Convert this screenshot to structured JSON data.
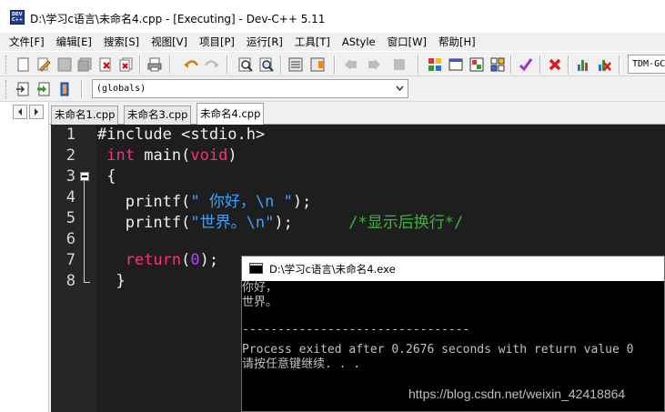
{
  "window": {
    "title": "D:\\学习c语言\\未命名4.cpp - [Executing] - Dev-C++ 5.11",
    "icon": "devcpp-app-icon",
    "icon_text": "DEV C++"
  },
  "menubar": {
    "items": [
      "文件[F]",
      "编辑[E]",
      "搜索[S]",
      "视图[V]",
      "项目[P]",
      "运行[R]",
      "工具[T]",
      "AStyle",
      "窗口[W]",
      "帮助[H]"
    ]
  },
  "toolbar": {
    "compiler_select": "TDM-GCC",
    "scope_select": "(globals)"
  },
  "tabs": {
    "items": [
      "未命名1.cpp",
      "未命名3.cpp",
      "未命名4.cpp"
    ],
    "active_index": 2
  },
  "editor": {
    "line_numbers": [
      "1",
      "2",
      "3",
      "4",
      "5",
      "6",
      "7",
      "8"
    ],
    "lines": [
      [
        {
          "t": "#include <stdio.h>",
          "c": "pp"
        }
      ],
      [
        {
          "t": " ",
          "c": ""
        },
        {
          "t": "int",
          "c": "kw"
        },
        {
          "t": " main(",
          "c": ""
        },
        {
          "t": "void",
          "c": "kw"
        },
        {
          "t": ")",
          "c": ""
        }
      ],
      [
        {
          "t": " {",
          "c": ""
        }
      ],
      [
        {
          "t": "   printf(",
          "c": ""
        },
        {
          "t": "\" 你好，",
          "c": "str"
        },
        {
          "t": "\\n",
          "c": "esc"
        },
        {
          "t": " \"",
          "c": "str"
        },
        {
          "t": ");",
          "c": ""
        }
      ],
      [
        {
          "t": "   printf(",
          "c": ""
        },
        {
          "t": "\"世界。",
          "c": "str"
        },
        {
          "t": "\\n",
          "c": "esc"
        },
        {
          "t": "\"",
          "c": "str"
        },
        {
          "t": ");      ",
          "c": ""
        },
        {
          "t": "/*显示后换行*/",
          "c": "cm"
        }
      ],
      [
        {
          "t": "",
          "c": ""
        }
      ],
      [
        {
          "t": "   ",
          "c": ""
        },
        {
          "t": "return",
          "c": "kw"
        },
        {
          "t": "(",
          "c": ""
        },
        {
          "t": "0",
          "c": "num"
        },
        {
          "t": ");",
          "c": ""
        }
      ],
      [
        {
          "t": "  }",
          "c": ""
        }
      ]
    ],
    "colors": {
      "background": "#1e1e1e",
      "keyword": "#ff2d82",
      "string": "#3fa0ff",
      "comment": "#3cb43c",
      "number": "#b040ff"
    }
  },
  "console": {
    "title": "D:\\学习c语言\\未命名4.exe",
    "lines": [
      "你好，",
      "世界。",
      "",
      "--------------------------------",
      "Process exited after 0.2676 seconds with return value 0",
      "请按任意键继续. . ."
    ]
  },
  "watermark": "https://blog.csdn.net/weixin_42418864"
}
